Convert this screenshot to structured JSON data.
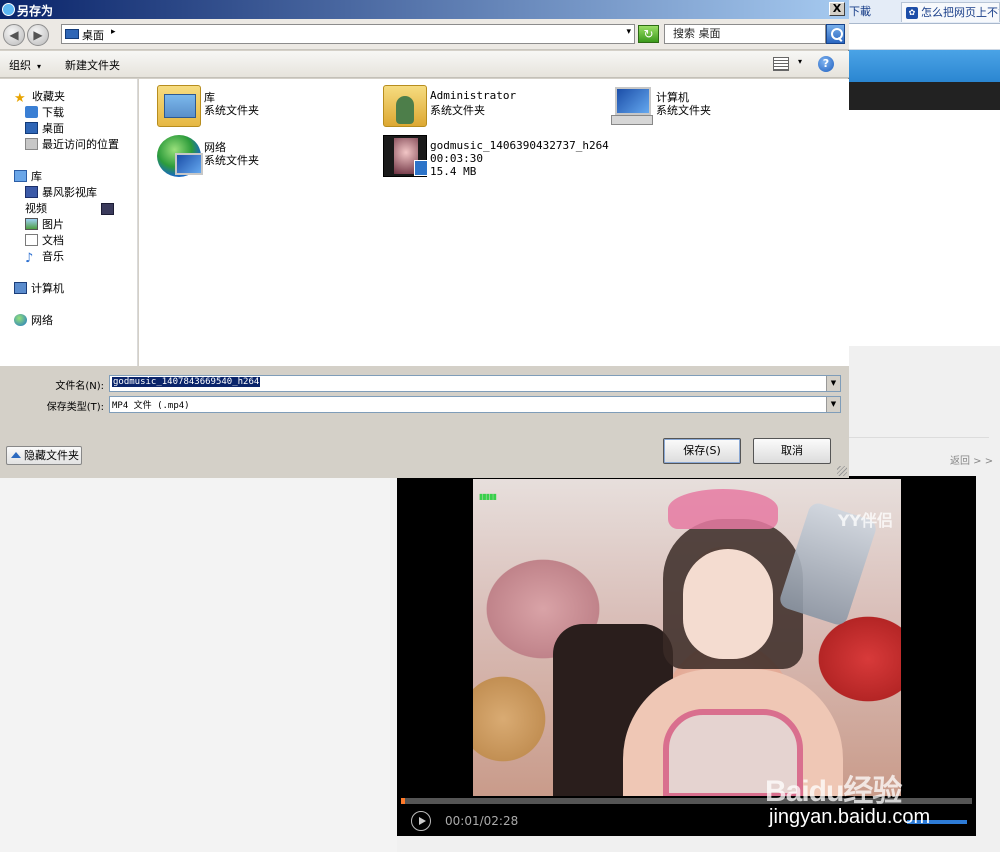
{
  "browser": {
    "tab1_label": "下載",
    "tab2_label": "怎么把网页上不能",
    "back_link": "返回 > >"
  },
  "dialog": {
    "title": "另存为",
    "close_glyph": "X",
    "address": {
      "location": "桌面",
      "separator": "▸",
      "dropdown": "▾"
    },
    "search": {
      "placeholder": "搜索 桌面"
    },
    "toolbar": {
      "organize": "组织",
      "organize_caret": "▾",
      "new_folder": "新建文件夹",
      "view_caret": "▾",
      "help": "?"
    },
    "nav": {
      "favorites": "收藏夹",
      "favorites_items": [
        "下载",
        "桌面",
        "最近访问的位置"
      ],
      "libraries": "库",
      "libraries_items": [
        "暴风影视库",
        "视频",
        "图片",
        "文档",
        "音乐"
      ],
      "computer": "计算机",
      "network": "网络"
    },
    "files": [
      {
        "name": "库",
        "type": "系统文件夹",
        "icon": "library-icon"
      },
      {
        "name": "Administrator",
        "type": "系统文件夹",
        "icon": "user-folder-icon"
      },
      {
        "name": "计算机",
        "type": "系统文件夹",
        "icon": "computer-icon"
      },
      {
        "name": "网络",
        "type": "系统文件夹",
        "icon": "network-icon"
      },
      {
        "name": "godmusic_1406390432737_h264",
        "duration": "00:03:30",
        "size": "15.4 MB",
        "icon": "video-file-icon"
      }
    ],
    "filename_label": "文件名(N):",
    "filename_value": "godmusic_1407843669540_h264",
    "filetype_label": "保存类型(T):",
    "filetype_value": "MP4 文件 (.mp4)",
    "hide_folders": "隐藏文件夹",
    "save": "保存(S)",
    "cancel": "取消"
  },
  "player": {
    "time": "00:01/02:28",
    "progress_fraction": 0.007,
    "overlay_brand": "YY伴侣",
    "watermark_logo": "Baidu经验",
    "watermark_url": "jingyan.baidu.com",
    "accent_color": "#ff7a2a"
  }
}
